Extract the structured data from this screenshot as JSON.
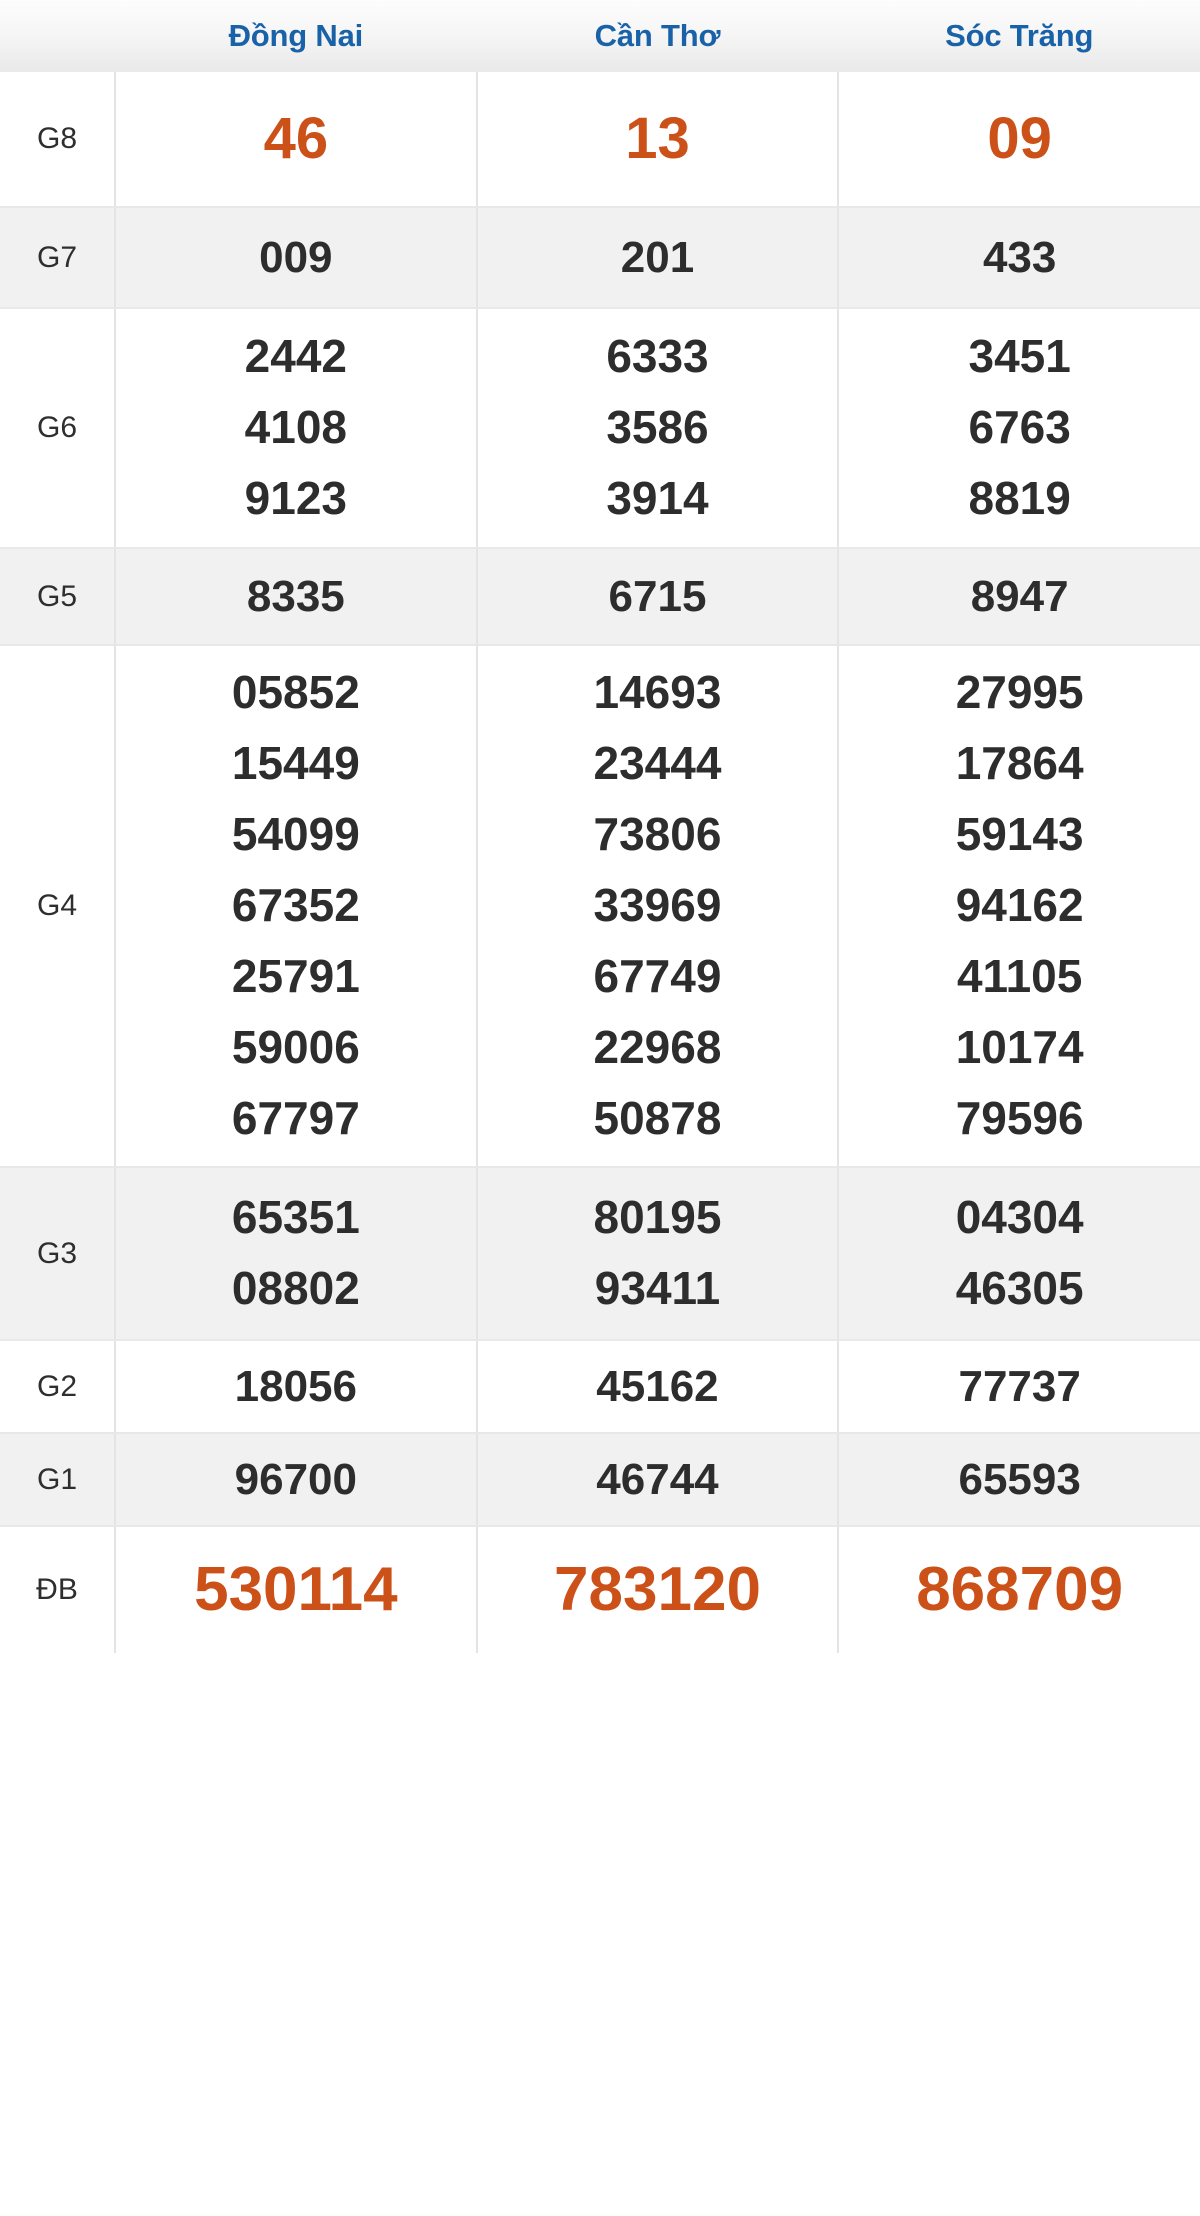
{
  "table": {
    "header": {
      "label_column": "",
      "provinces": [
        "Đồng Nai",
        "Cần Thơ",
        "Sóc Trăng"
      ]
    },
    "colors": {
      "header_text": "#1a62a8",
      "highlight_number": "#cc5119",
      "number": "#2d2d2d",
      "stripe": "#f1f1f1",
      "border": "#e4e4e4"
    },
    "rows": [
      {
        "label": "G8",
        "stripe": "white",
        "highlight": true,
        "values": [
          [
            "46"
          ],
          [
            "13"
          ],
          [
            "09"
          ]
        ]
      },
      {
        "label": "G7",
        "stripe": "gray",
        "highlight": false,
        "values": [
          [
            "009"
          ],
          [
            "201"
          ],
          [
            "433"
          ]
        ]
      },
      {
        "label": "G6",
        "stripe": "white",
        "highlight": false,
        "values": [
          [
            "2442",
            "4108",
            "9123"
          ],
          [
            "6333",
            "3586",
            "3914"
          ],
          [
            "3451",
            "6763",
            "8819"
          ]
        ]
      },
      {
        "label": "G5",
        "stripe": "gray",
        "highlight": false,
        "values": [
          [
            "8335"
          ],
          [
            "6715"
          ],
          [
            "8947"
          ]
        ]
      },
      {
        "label": "G4",
        "stripe": "white",
        "highlight": false,
        "values": [
          [
            "05852",
            "15449",
            "54099",
            "67352",
            "25791",
            "59006",
            "67797"
          ],
          [
            "14693",
            "23444",
            "73806",
            "33969",
            "67749",
            "22968",
            "50878"
          ],
          [
            "27995",
            "17864",
            "59143",
            "94162",
            "41105",
            "10174",
            "79596"
          ]
        ]
      },
      {
        "label": "G3",
        "stripe": "gray",
        "highlight": false,
        "values": [
          [
            "65351",
            "08802"
          ],
          [
            "80195",
            "93411"
          ],
          [
            "04304",
            "46305"
          ]
        ]
      },
      {
        "label": "G2",
        "stripe": "white",
        "highlight": false,
        "values": [
          [
            "18056"
          ],
          [
            "45162"
          ],
          [
            "77737"
          ]
        ]
      },
      {
        "label": "G1",
        "stripe": "gray",
        "highlight": false,
        "values": [
          [
            "96700"
          ],
          [
            "46744"
          ],
          [
            "65593"
          ]
        ]
      },
      {
        "label": "ĐB",
        "stripe": "white",
        "highlight": true,
        "values": [
          [
            "530114"
          ],
          [
            "783120"
          ],
          [
            "868709"
          ]
        ]
      }
    ]
  }
}
